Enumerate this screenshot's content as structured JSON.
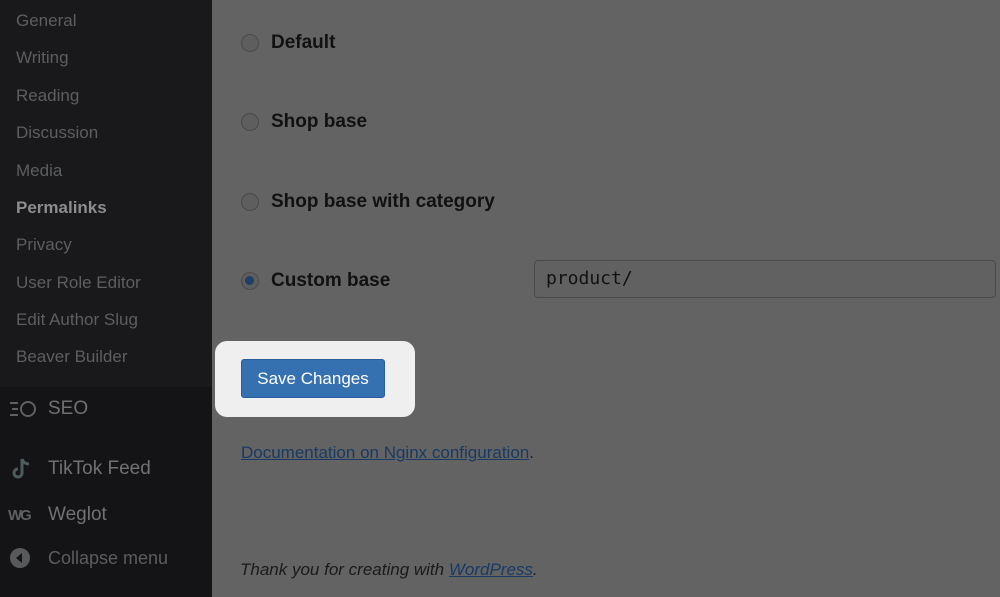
{
  "sidebar": {
    "settings_submenu": [
      {
        "label": "General",
        "current": false
      },
      {
        "label": "Writing",
        "current": false
      },
      {
        "label": "Reading",
        "current": false
      },
      {
        "label": "Discussion",
        "current": false
      },
      {
        "label": "Media",
        "current": false
      },
      {
        "label": "Permalinks",
        "current": true
      },
      {
        "label": "Privacy",
        "current": false
      },
      {
        "label": "User Role Editor",
        "current": false
      },
      {
        "label": "Edit Author Slug",
        "current": false
      },
      {
        "label": "Beaver Builder",
        "current": false
      }
    ],
    "menu": [
      {
        "label": "SEO",
        "icon": "seo-icon"
      },
      {
        "label": "TikTok Feed",
        "icon": "tiktok-icon"
      },
      {
        "label": "Weglot",
        "icon": "weglot-icon"
      },
      {
        "label": "Collapse menu",
        "icon": "collapse-icon"
      }
    ]
  },
  "product_permalinks": {
    "options": [
      {
        "label": "Default",
        "checked": false
      },
      {
        "label": "Shop base",
        "checked": false
      },
      {
        "label": "Shop base with category",
        "checked": false
      },
      {
        "label": "Custom base",
        "checked": true
      }
    ],
    "custom_base_value": "product/"
  },
  "actions": {
    "save_label": "Save Changes"
  },
  "documentation": {
    "link_text": "Documentation on Nginx configuration",
    "suffix": "."
  },
  "footer": {
    "prefix": "Thank you for creating with ",
    "link_text": "WordPress",
    "suffix": "."
  },
  "colors": {
    "accent": "#3570b0",
    "overlay_bg": "#636363",
    "sidebar_bg": "#141416"
  }
}
